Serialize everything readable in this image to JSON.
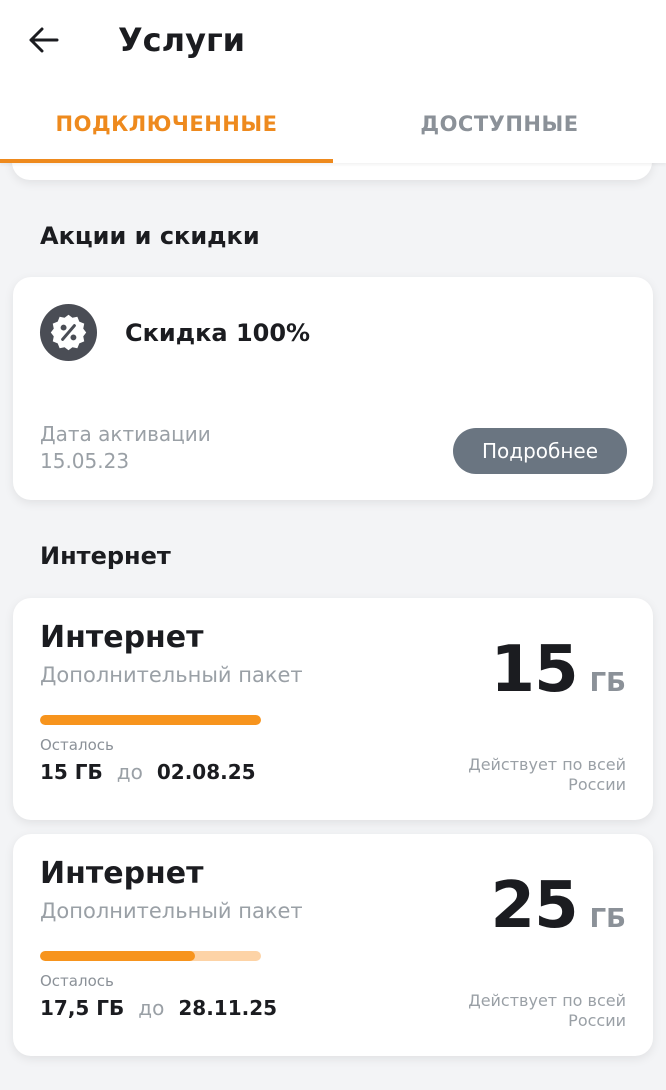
{
  "header": {
    "title": "Услуги",
    "back_icon": "arrow-left-icon"
  },
  "tabs": [
    {
      "label": "ПОДКЛЮЧЕННЫЕ",
      "active": true
    },
    {
      "label": "ДОСТУПНЫЕ",
      "active": false
    }
  ],
  "colors": {
    "accent": "#ee8a1e",
    "progress_fill": "#f7941d",
    "progress_track": "#fdd3a6",
    "button_bg": "#6a7581",
    "background": "#f3f4f6"
  },
  "promotions": {
    "section_title": "Акции и скидки",
    "item": {
      "icon": "discount-badge-icon",
      "name": "Скидка 100%",
      "date_label": "Дата активации",
      "date_value": "15.05.23",
      "details_button": "Подробнее"
    }
  },
  "internet": {
    "section_title": "Интернет",
    "packages": [
      {
        "name": "Интернет",
        "subtitle": "Дополнительный пакет",
        "amount": "15",
        "unit": "ГБ",
        "progress_fraction": 1.0,
        "left_label": "Осталось",
        "left_value": "15 ГБ",
        "until_word": "до",
        "until_date": "02.08.25",
        "coverage": "Действует по всей России"
      },
      {
        "name": "Интернет",
        "subtitle": "Дополнительный пакет",
        "amount": "25",
        "unit": "ГБ",
        "progress_fraction": 0.7,
        "left_label": "Осталось",
        "left_value": "17,5 ГБ",
        "until_word": "до",
        "until_date": "28.11.25",
        "coverage": "Действует по всей России"
      }
    ]
  }
}
